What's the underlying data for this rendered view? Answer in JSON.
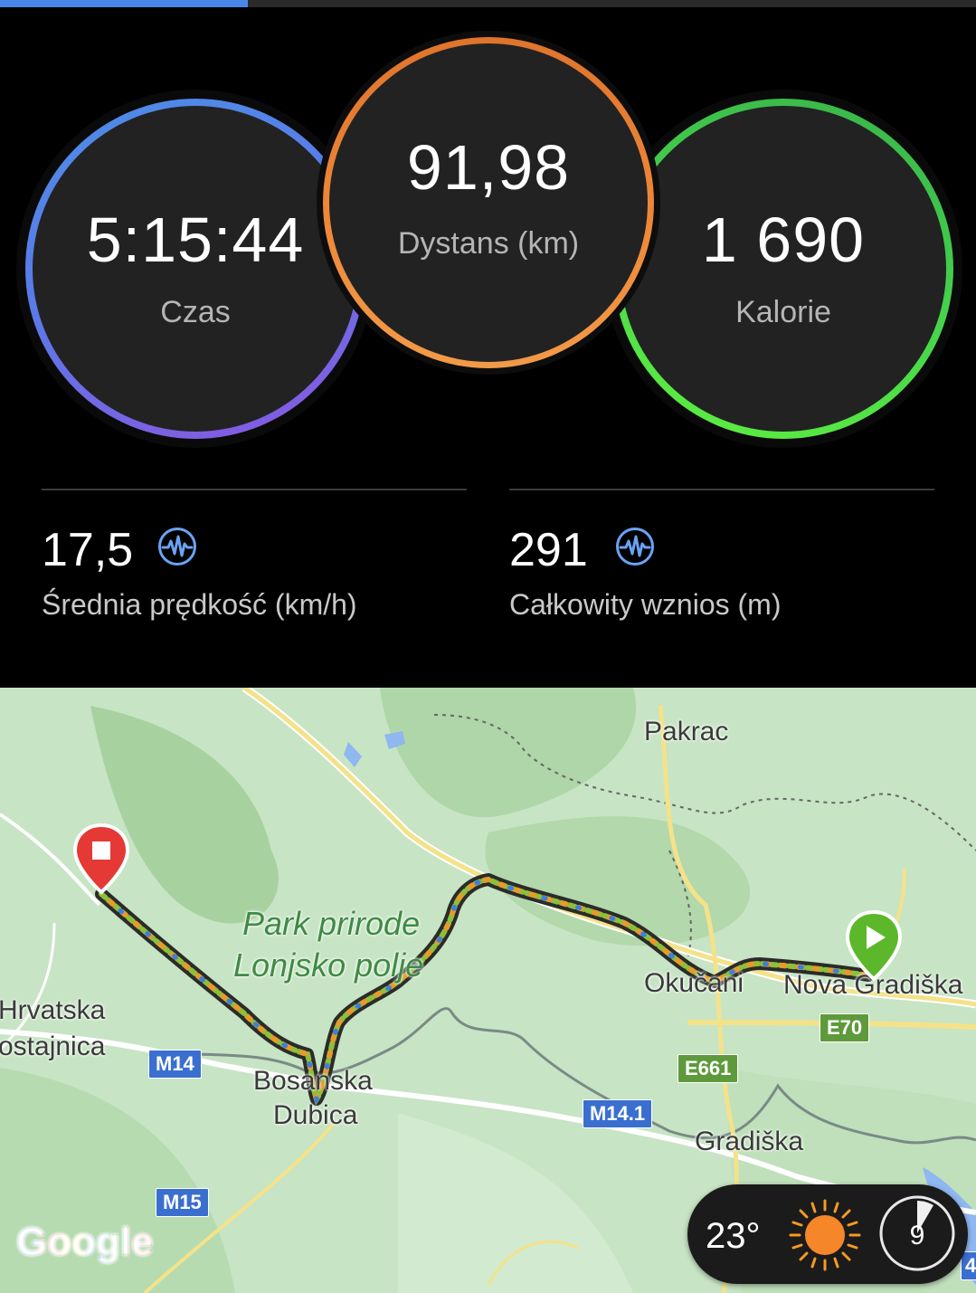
{
  "stats": {
    "time": {
      "value": "5:15:44",
      "label": "Czas"
    },
    "distance": {
      "value": "91,98",
      "label": "Dystans (km)"
    },
    "calories": {
      "value": "1 690",
      "label": "Kalorie"
    },
    "avg_speed": {
      "value": "17,5",
      "label": "Średnia prędkość (km/h)",
      "icon": "heart-rate-icon"
    },
    "elevation": {
      "value": "291",
      "label": "Całkowity wznios (m)",
      "icon": "heart-rate-icon"
    }
  },
  "map": {
    "places": {
      "pakrac": "Pakrac",
      "park1": "Park prirode",
      "park2": "Lonjsko polje",
      "okucani": "Okučani",
      "nova_gradiska": "Nova Gradiška",
      "hrvatska": "Hrvatska",
      "kostajnica": "ostajnica",
      "bosanska": "Bosanska",
      "dubica": "Dubica",
      "gradiska": "Gradiška"
    },
    "roads": {
      "m14": "M14",
      "m14_1": "M14.1",
      "m15": "M15",
      "e661": "E661",
      "e70": "E70",
      "partial": "4."
    },
    "attribution": "Google",
    "start_marker": "play-icon",
    "end_marker": "stop-icon"
  },
  "weather": {
    "temperature": "23°",
    "icon": "sun-icon",
    "wind_value": "9"
  },
  "colors": {
    "time_ring": "#5a7ae8",
    "distance_ring": "#ee8a3a",
    "calories_ring": "#46d44c",
    "accent": "#4a86e8",
    "start_marker": "#5cb82a",
    "end_marker": "#e53935"
  }
}
